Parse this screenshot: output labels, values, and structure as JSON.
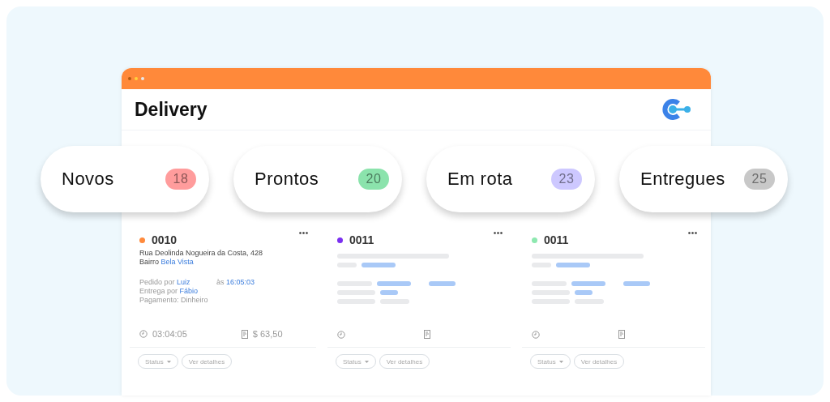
{
  "window": {
    "title": "Delivery"
  },
  "columns": [
    {
      "label": "Novos",
      "count": "18",
      "color": "#ff9c9c"
    },
    {
      "label": "Prontos",
      "count": "20",
      "color": "#8be3ac"
    },
    {
      "label": "Em rota",
      "count": "23",
      "color": "#cdc8ff"
    },
    {
      "label": "Entregues",
      "count": "25",
      "color": "#c8c8c8"
    }
  ],
  "cards": [
    {
      "kind": "full",
      "number": "0010",
      "color": "#ff8a3c",
      "address": [
        [
          {
            "text": "Rua Deolinda Nogueira da Costa, 428",
            "highlight": false
          }
        ],
        [
          {
            "text": "Bairro ",
            "highlight": false
          },
          {
            "text": "Bela Vista",
            "highlight": true
          }
        ]
      ],
      "details": [
        [
          {
            "text": "Pedido por ",
            "highlight": false
          },
          {
            "text": "Luiz",
            "highlight": true
          },
          {
            "text": "             às ",
            "highlight": false
          },
          {
            "text": "16:05:03",
            "highlight": true
          }
        ],
        [
          {
            "text": "Entrega por ",
            "highlight": false
          },
          {
            "text": "Fábio",
            "highlight": true
          }
        ],
        [
          {
            "text": "Pagamento: Dinheiro",
            "highlight": false
          }
        ]
      ],
      "time": "03:04:05",
      "total": "$ 63,50",
      "status_button": "Status",
      "details_button": "Ver detalhes"
    },
    {
      "kind": "skeleton",
      "number": "0011",
      "color": "#7b2ff0",
      "status_button": "Status",
      "details_button": "Ver detalhes"
    },
    {
      "kind": "skeleton",
      "number": "0011",
      "color": "#8ee8b0",
      "status_button": "Status",
      "details_button": "Ver detalhes"
    }
  ]
}
